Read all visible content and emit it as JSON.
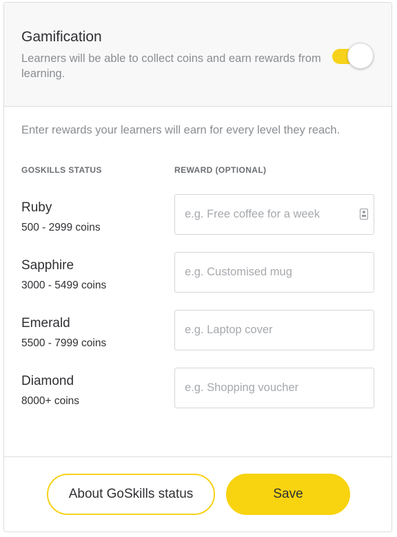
{
  "header": {
    "title": "Gamification",
    "description": "Learners will be able to collect coins and earn rewards from learning.",
    "toggle_on": true
  },
  "intro": "Enter rewards your learners will earn for every level they reach.",
  "columns": {
    "status": "GOSKILLS STATUS",
    "reward": "REWARD (OPTIONAL)"
  },
  "levels": [
    {
      "name": "Ruby",
      "coins": "500 - 2999 coins",
      "placeholder": "e.g. Free coffee for a week",
      "value": ""
    },
    {
      "name": "Sapphire",
      "coins": "3000 - 5499 coins",
      "placeholder": "e.g. Customised mug",
      "value": ""
    },
    {
      "name": "Emerald",
      "coins": "5500 - 7999 coins",
      "placeholder": "e.g. Laptop cover",
      "value": ""
    },
    {
      "name": "Diamond",
      "coins": "8000+ coins",
      "placeholder": "e.g. Shopping voucher",
      "value": ""
    }
  ],
  "buttons": {
    "about": "About GoSkills status",
    "save": "Save"
  },
  "colors": {
    "accent": "#f8d30f",
    "text": "#2f3033",
    "muted": "#8a8d91",
    "border": "#dddddd"
  },
  "icons": {
    "input_autofill": "contact-card-icon"
  }
}
